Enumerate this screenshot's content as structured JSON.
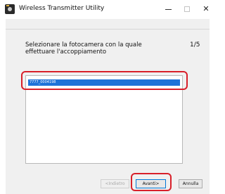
{
  "window": {
    "title": "Wireless Transmitter Utility",
    "controls": {
      "minimize": "–",
      "maximize": "□",
      "close": "✕"
    }
  },
  "wizard": {
    "prompt_line1": "Selezionare la fotocamera con la quale",
    "prompt_line2": "effettuare l'accoppiamento",
    "page_counter": "1/5"
  },
  "camera_list": {
    "items": [
      {
        "label": "7777_0004198",
        "selected": true
      }
    ]
  },
  "buttons": {
    "back": "<Indietro",
    "next": "Avanti>",
    "cancel": "Annulla"
  },
  "colors": {
    "selection": "#1e73d8",
    "callout": "#d8202a"
  }
}
